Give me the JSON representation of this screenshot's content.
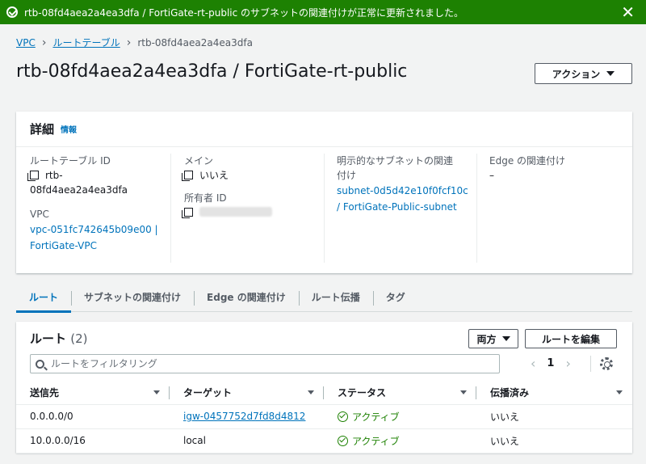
{
  "banner": {
    "message": "rtb-08fd4aea2a4ea3dfa / FortiGate-rt-public のサブネットの関連付けが正常に更新されました。",
    "color": "#1d8102"
  },
  "breadcrumb": {
    "items": [
      "VPC",
      "ルートテーブル",
      "rtb-08fd4aea2a4ea3dfa"
    ]
  },
  "page": {
    "title": "rtb-08fd4aea2a4ea3dfa / FortiGate-rt-public",
    "action_label": "アクション"
  },
  "details": {
    "title": "詳細",
    "info_label": "情報",
    "route_table_id_label": "ルートテーブル ID",
    "route_table_id_line1": "rtb-",
    "route_table_id_line2": "08fd4aea2a4ea3dfa",
    "vpc_label": "VPC",
    "vpc_line1": "vpc-051fc742645b09e00 |",
    "vpc_line2": "FortiGate-VPC",
    "main_label": "メイン",
    "main_value": "いいえ",
    "owner_label": "所有者 ID",
    "explicit_subnet_label_line1": "明示的なサブネットの関連",
    "explicit_subnet_label_line2": "付け",
    "explicit_subnet_line1": "subnet-0d5d42e10f0fcf10c",
    "explicit_subnet_line2": "/ FortiGate-Public-subnet",
    "edge_label": "Edge の関連付け",
    "edge_value": "–"
  },
  "tabs": [
    "ルート",
    "サブネットの関連付け",
    "Edge の関連付け",
    "ルート伝播",
    "タグ"
  ],
  "routes": {
    "title": "ルート",
    "count": "(2)",
    "filter_select": "両方",
    "edit_button": "ルートを編集",
    "search_placeholder": "ルートをフィルタリング",
    "page_number": "1",
    "columns": [
      "送信先",
      "ターゲット",
      "ステータス",
      "伝播済み"
    ],
    "rows": [
      {
        "destination": "0.0.0.0/0",
        "target": "igw-0457752d7fd8d4812",
        "status": "アクティブ",
        "propagated": "いいえ"
      },
      {
        "destination": "10.0.0.0/16",
        "target": "local",
        "status": "アクティブ",
        "propagated": "いいえ"
      }
    ]
  },
  "colors": {
    "link": "#0073bb",
    "success": "#1d8102"
  }
}
